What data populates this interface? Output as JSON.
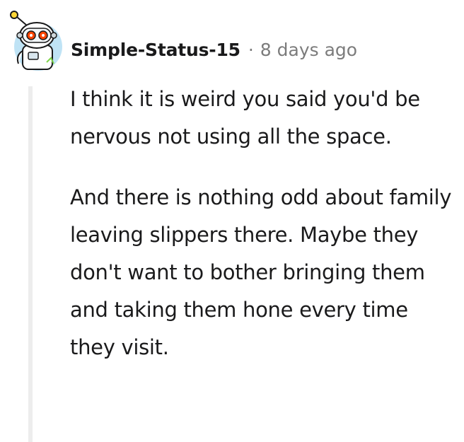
{
  "comment": {
    "author": "Simple-Status-15",
    "separator": "·",
    "time_ago": "8 days ago",
    "avatar_icon": "snoo-robot-avatar-icon",
    "paragraphs": [
      "I think it is weird you said you'd be nervous not using all the space.",
      "And there is nothing odd about family leaving slippers there. Maybe they don't want to bother bringing them and taking them hone every time they visit."
    ]
  },
  "colors": {
    "text": "#1a1a1b",
    "meta": "#7c7c7c",
    "thread_line": "#ededed",
    "avatar_bg": "#bfe3f5",
    "eye": "#ff4500"
  }
}
